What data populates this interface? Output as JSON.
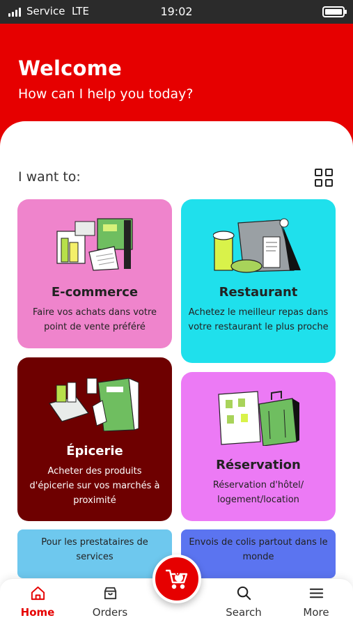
{
  "status_bar": {
    "carrier": "Service",
    "network": "LTE",
    "time": "19:02"
  },
  "header": {
    "title": "Welcome",
    "subtitle": "How can I help you today?"
  },
  "section": {
    "label": "I want to:"
  },
  "cards": [
    {
      "title": "E-commerce",
      "description": "Faire vos achats dans votre point de vente préféré",
      "color": "#ef84cc"
    },
    {
      "title": "Restaurant",
      "description": "Achetez le meilleur repas dans votre restaurant le plus proche",
      "color": "#1fe0ec"
    },
    {
      "title": "Épicerie",
      "description": "Acheter des produits d'épicerie sur vos marchés à proximité",
      "color": "#6e0000"
    },
    {
      "title": "Réservation",
      "description": "Réservation d'hôtel/ logement/location",
      "color": "#ec7af5"
    },
    {
      "title": "",
      "description": "Pour les prestataires de services",
      "color": "#6ec8ee"
    },
    {
      "title": "",
      "description": "Envois de colis partout dans le monde",
      "color": "#5b74f0"
    }
  ],
  "cart": {
    "count": "0"
  },
  "nav": [
    {
      "label": "Home",
      "icon": "home-icon",
      "active": true
    },
    {
      "label": "Orders",
      "icon": "bag-icon"
    },
    {
      "label": "Search",
      "icon": "search-icon"
    },
    {
      "label": "More",
      "icon": "menu-icon"
    }
  ],
  "colors": {
    "brand": "#e60000",
    "active_nav": "#e60000"
  }
}
